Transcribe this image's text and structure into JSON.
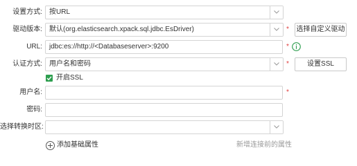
{
  "form": {
    "setup_mode": {
      "label": "设置方式:",
      "value": "按URL"
    },
    "driver": {
      "label": "驱动版本:",
      "value": "默认(org.elasticsearch.xpack.sql.jdbc.EsDriver)",
      "required": "*",
      "button": "选择自定义驱动"
    },
    "url": {
      "label": "URL:",
      "value": "jdbc:es://http://<Databaseserver>:9200",
      "required": "*"
    },
    "auth": {
      "label": "认证方式:",
      "value": "用户名和密码",
      "required": "*",
      "button": "设置SSL"
    },
    "ssl": {
      "label": "开启SSL",
      "checked": true
    },
    "username": {
      "label": "用户名:",
      "value": "",
      "required": "*"
    },
    "password": {
      "label": "密码:",
      "value": ""
    },
    "timezone": {
      "label": "选择转换时区:",
      "value": ""
    },
    "add_attr": {
      "label": "添加基础属性"
    },
    "new_attr_hint": "新增连接前的属性"
  },
  "colors": {
    "required": "#e03e3e",
    "check": "#2e9e4f",
    "info": "#2e9e4f",
    "hint": "#999999"
  },
  "icons": [
    "chevron-down-icon",
    "info-icon",
    "check-icon",
    "add-circle-icon"
  ]
}
